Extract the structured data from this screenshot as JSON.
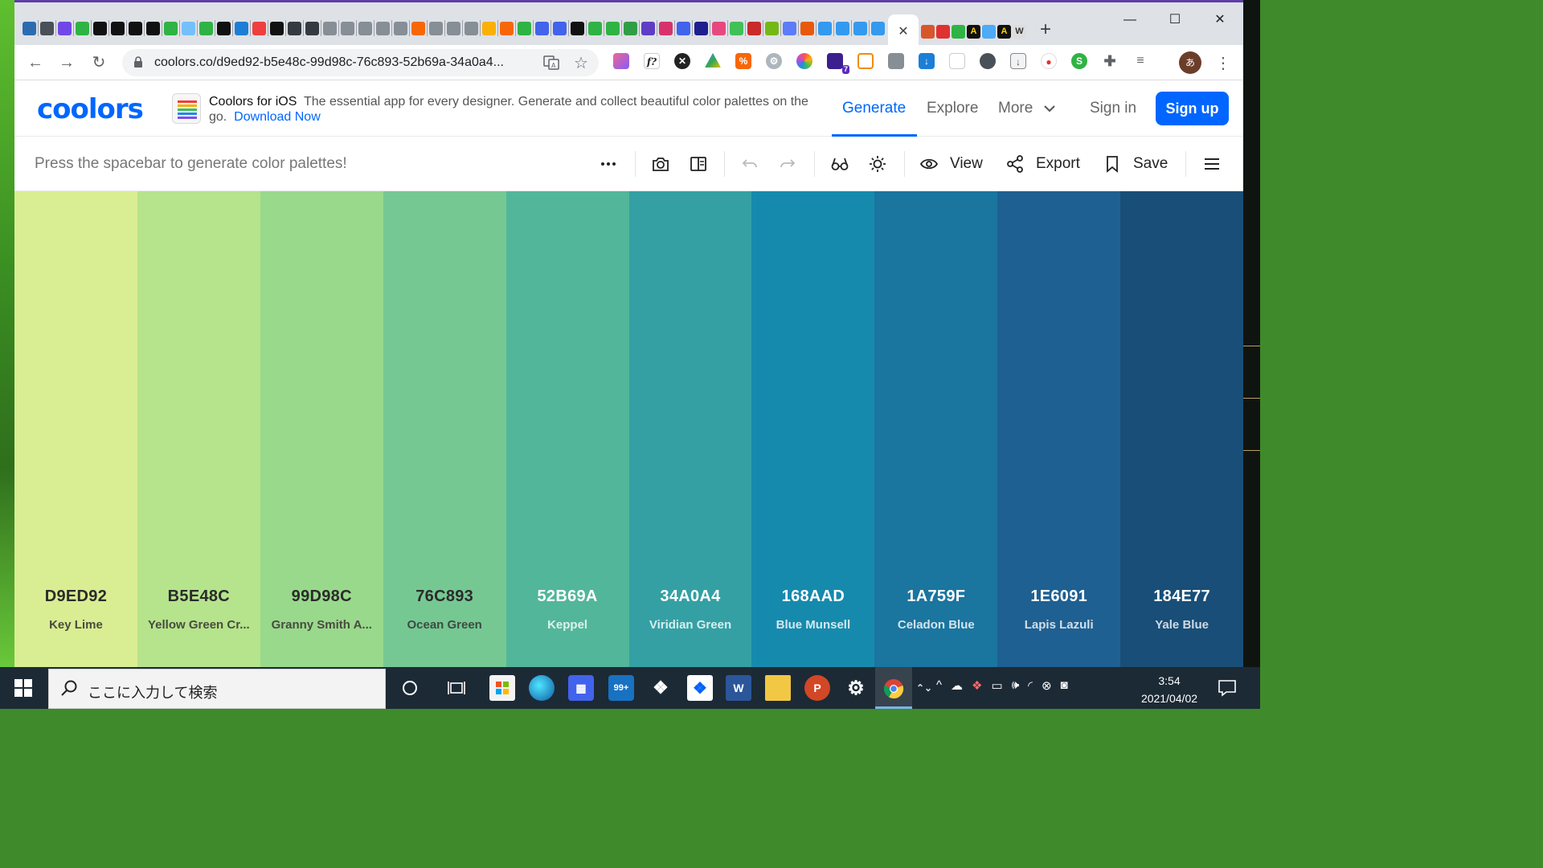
{
  "browser": {
    "window_controls": {
      "minimize": "—",
      "maximize": "☐",
      "close": "✕"
    },
    "active_tab_close": "✕",
    "new_tab": "+",
    "url": "coolors.co/d9ed92-b5e48c-99d98c-76c893-52b69a-34a0a4...",
    "nav": {
      "back": "←",
      "forward": "→",
      "reload": "↻"
    },
    "profile_initial": "あ",
    "menu": "⋮",
    "extension_badge": "7"
  },
  "site": {
    "logo": "coolors",
    "promo": {
      "title": "Coolors for iOS",
      "text": "The essential app for every designer. Generate and collect beautiful color palettes on the go.",
      "link": "Download Now"
    },
    "nav": {
      "generate": "Generate",
      "explore": "Explore",
      "more": "More",
      "signin": "Sign in",
      "signup": "Sign up"
    },
    "accent": "#0066ff"
  },
  "generator": {
    "hint": "Press the spacebar to generate color palettes!",
    "view": "View",
    "export": "Export",
    "save": "Save"
  },
  "palette": [
    {
      "hex": "D9ED92",
      "name": "Key Lime",
      "color": "#D9ED92",
      "text": "#2b2b2b",
      "sub": "#4a4a40"
    },
    {
      "hex": "B5E48C",
      "name": "Yellow Green Cr...",
      "color": "#B5E48C",
      "text": "#2b2b2b",
      "sub": "#4a4a40"
    },
    {
      "hex": "99D98C",
      "name": "Granny Smith A...",
      "color": "#99D98C",
      "text": "#2b2b2b",
      "sub": "#4a4a40"
    },
    {
      "hex": "76C893",
      "name": "Ocean Green",
      "color": "#76C893",
      "text": "#2b2b2b",
      "sub": "#3d4b42"
    },
    {
      "hex": "52B69A",
      "name": "Keppel",
      "color": "#52B69A",
      "text": "#ffffff",
      "sub": "#dff2ec"
    },
    {
      "hex": "34A0A4",
      "name": "Viridian Green",
      "color": "#34A0A4",
      "text": "#ffffff",
      "sub": "#d8eeef"
    },
    {
      "hex": "168AAD",
      "name": "Blue Munsell",
      "color": "#168AAD",
      "text": "#ffffff",
      "sub": "#d4e8ef"
    },
    {
      "hex": "1A759F",
      "name": "Celadon Blue",
      "color": "#1A759F",
      "text": "#ffffff",
      "sub": "#d3e3ec"
    },
    {
      "hex": "1E6091",
      "name": "Lapis Lazuli",
      "color": "#1E6091",
      "text": "#ffffff",
      "sub": "#d3dfea"
    },
    {
      "hex": "184E77",
      "name": "Yale Blue",
      "color": "#184E77",
      "text": "#ffffff",
      "sub": "#d0dae4"
    }
  ],
  "taskbar": {
    "search_placeholder": "ここに入力して検索",
    "mail_badge": "99+",
    "time": "3:54",
    "date": "2021/04/02"
  }
}
